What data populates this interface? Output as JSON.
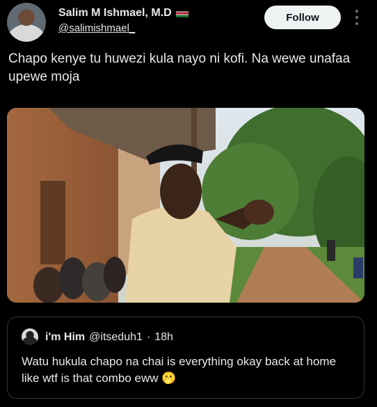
{
  "author": {
    "name": "Salim M Ishmael, M.D",
    "handle": "@salimishmael_",
    "flag_icon": "kenya-flag-icon"
  },
  "header": {
    "follow_label": "Follow"
  },
  "tweet": {
    "text": "Chapo kenye tu huwezi kula nayo ni kofi. Na wewe unafaa upewe moja"
  },
  "quote": {
    "name": "i'm Him",
    "handle": "@itseduh1",
    "separator": "·",
    "time": "18h",
    "text": "Watu hukula chapo na chai is everything okay back at home like wtf is that combo eww 🫢"
  },
  "colors": {
    "background": "#000000",
    "text": "#e7e9ea",
    "follow_bg": "#eff3f4",
    "border": "#333639"
  }
}
